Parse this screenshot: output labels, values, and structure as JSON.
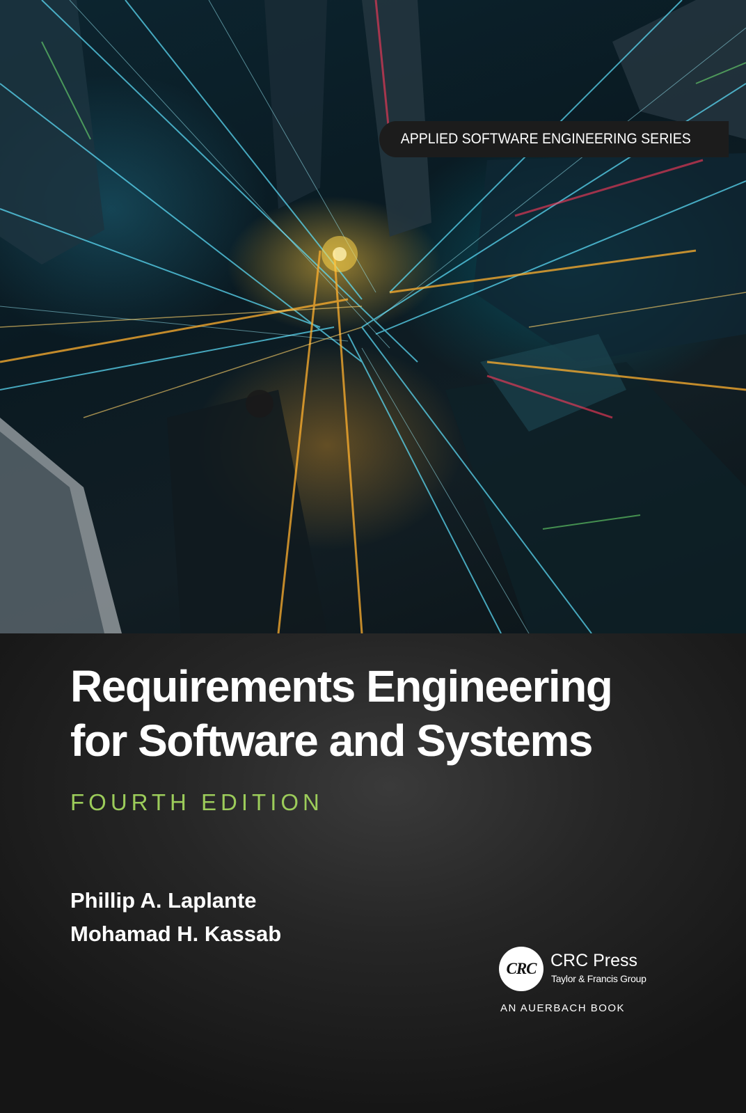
{
  "series": "APPLIED SOFTWARE ENGINEERING SERIES",
  "title_lines": [
    "Requirements Engineering",
    "for Software and Systems"
  ],
  "edition": "FOURTH EDITION",
  "authors": [
    "Phillip A. Laplante",
    "Mohamad H. Kassab"
  ],
  "publisher": {
    "logo_text": "CRC",
    "name": "CRC Press",
    "group": "Taylor & Francis Group",
    "imprint": "AN AUERBACH BOOK"
  },
  "colors": {
    "edition_green": "#9ccc5a",
    "title_white": "#ffffff",
    "background_dark": "#1e1e1e"
  }
}
